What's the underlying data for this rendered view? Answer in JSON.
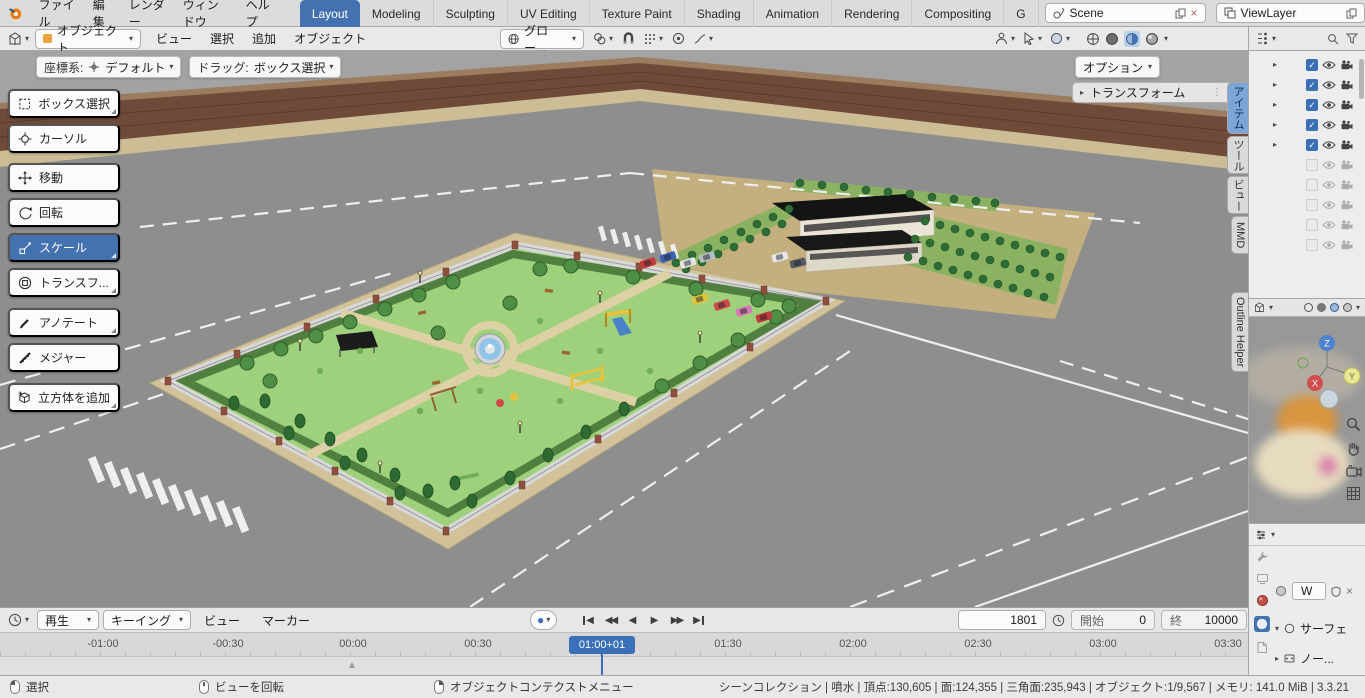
{
  "topbar": {
    "menus": [
      "ファイル",
      "編集",
      "レンダー",
      "ウィンドウ",
      "ヘルプ"
    ],
    "tabs": [
      "Layout",
      "Modeling",
      "Sculpting",
      "UV Editing",
      "Texture Paint",
      "Shading",
      "Animation",
      "Rendering",
      "Compositing",
      "G"
    ],
    "scene_field": {
      "value": "Scene"
    },
    "viewlayer_field": {
      "value": "ViewLayer"
    }
  },
  "viewport_header": {
    "mode_value": "オブジェクト",
    "menu_view": "ビュー",
    "menu_select": "選択",
    "menu_add": "追加",
    "menu_object": "オブジェクト",
    "orientation_value": "グロー..."
  },
  "viewport_overlay": {
    "coord_label": "座標系:",
    "coord_value": "デフォルト",
    "drag_label": "ドラッグ:",
    "drag_value": "ボックス選択",
    "options_label": "オプション",
    "transform_panel_label": "トランスフォーム"
  },
  "toolbar": {
    "tool_box_select": "ボックス選択",
    "tool_cursor": "カーソル",
    "tool_move": "移動",
    "tool_rotate": "回転",
    "tool_scale": "スケール",
    "tool_transform": "トランスフ...",
    "tool_annotate": "アノテート",
    "tool_measure": "メジャー",
    "tool_add_cube": "立方体を追加"
  },
  "sidebar_tabs": {
    "item": "アイテム",
    "tool": "ツール",
    "view": "ビュー",
    "mmd": "MMD",
    "outline_helper": "Outline Helper"
  },
  "timeline": {
    "playback_label": "再生",
    "keying_label": "キーイング",
    "view_label": "ビュー",
    "marker_label": "マーカー",
    "current_frame": "1801",
    "start_label": "開始",
    "start_value": "0",
    "end_label": "終",
    "end_value": "10000",
    "playhead_label": "01:00+01",
    "ruler_labels": [
      "-01:00",
      "-00:30",
      "00:00",
      "00:30",
      "01:30",
      "02:00",
      "02:30",
      "03:00",
      "03:30"
    ]
  },
  "statusbar": {
    "hint_select": "選択",
    "hint_rotate": "ビューを回転",
    "hint_context": "オブジェクトコンテクストメニュー",
    "stats": "シーンコレクション | 噴水 | 頂点:130,605 | 面:124,355 | 三角面:235,943 | オブジェクト:1/9,567 | メモリ: 141.0 MiB | 3.3.21"
  },
  "properties_panel": {
    "material_value": "W",
    "surface_label": "サーフェ",
    "nodes_label": "ノー..."
  },
  "icons": {
    "caret_down": "▾",
    "caret_right": "▸",
    "check": "✓",
    "close": "×",
    "play": "▶",
    "play_back": "◀",
    "rewind": "◀◀",
    "fast_forward": "▶▶",
    "marker": "▲",
    "record_dot": "●",
    "menu_grip": "⋮"
  }
}
